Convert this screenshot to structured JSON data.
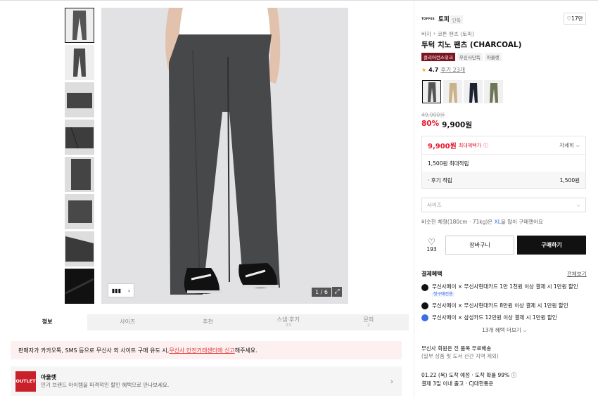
{
  "gallery": {
    "counter": "1 / 6",
    "thumbs": [
      "front-view",
      "front-view-2",
      "detail-waist",
      "detail-pocket",
      "detail-side",
      "detail-back",
      "detail-hem",
      "fabric-closeup"
    ]
  },
  "tabs": [
    {
      "label": "정보",
      "sub": ""
    },
    {
      "label": "사이즈",
      "sub": ""
    },
    {
      "label": "추천",
      "sub": ""
    },
    {
      "label": "스냅·후기",
      "sub": "23"
    },
    {
      "label": "문의",
      "sub": "2"
    }
  ],
  "alert": {
    "text_before": "판매자가 카카오톡, SMS 등으로 무신사 외 사이트 구매 유도 시, ",
    "link": "무신사 안전거래센터에 신고",
    "text_after": " 해주세요."
  },
  "outlet": {
    "logo": "OUTLET",
    "title": "아울렛",
    "desc": "인기 브랜드 아이템을 파격적인 할인 혜택으로 만나보세요."
  },
  "brand": {
    "logo": "TOFFEE",
    "name": "토피",
    "tag": "단독",
    "likes": "17만"
  },
  "breadcrumb": {
    "first": "바지",
    "sep": "›",
    "second": "코튼 팬츠 (토피)"
  },
  "product": {
    "title": "투턱 치노 팬츠 (CHARCOAL)",
    "badges": [
      "클리어런스위크",
      "무신사단독",
      "아울렛"
    ],
    "rating": "4.7",
    "reviews": "후기 23개",
    "orig_price": "49,900원",
    "discount": "80%",
    "price": "9,900원"
  },
  "price_box": {
    "max_price": "9,900원",
    "max_label": "최대혜택가",
    "detail": "자세히",
    "points": "1,500원 최대적립",
    "review_label": "· 후기 적립",
    "review_value": "1,500원"
  },
  "size": {
    "placeholder": "사이즈",
    "hint_before": "비슷한 체형(180cm · 71kg)은 ",
    "hint_size": "XL",
    "hint_after": "을 많이 구매했어요"
  },
  "actions": {
    "like_count": "193",
    "cart": "장바구니",
    "buy": "구매하기"
  },
  "benefits": {
    "title": "결제혜택",
    "all": "전체보기",
    "items": [
      {
        "text": "무신사페이 × 무신사현대카드 1만 1천원 이상 결제 시 1만원 할인",
        "tag": "첫구매전용"
      },
      {
        "text": "무신사페이 × 무신사현대카드 8만원 이상 결제 시 1만원 할인",
        "tag": ""
      },
      {
        "text": "무신사페이 × 삼성카드 12만원 이상 결제 시 1만원 할인",
        "tag": ""
      }
    ],
    "more": "13개 혜택 더보기"
  },
  "shipping": {
    "free": "무신사 회원은 전 품목 무료배송",
    "free_note": "(일부 상품 및 도서 산간 지역 제외)",
    "eta": "01.22 (목) 도착 예정 · 도착 확률 99%",
    "dispatch": "결제 3일 이내 출고 · CJ대한통운"
  },
  "colors": {
    "accent": "#e6192d",
    "blue": "#3b6ee5",
    "dark": "#111111"
  }
}
